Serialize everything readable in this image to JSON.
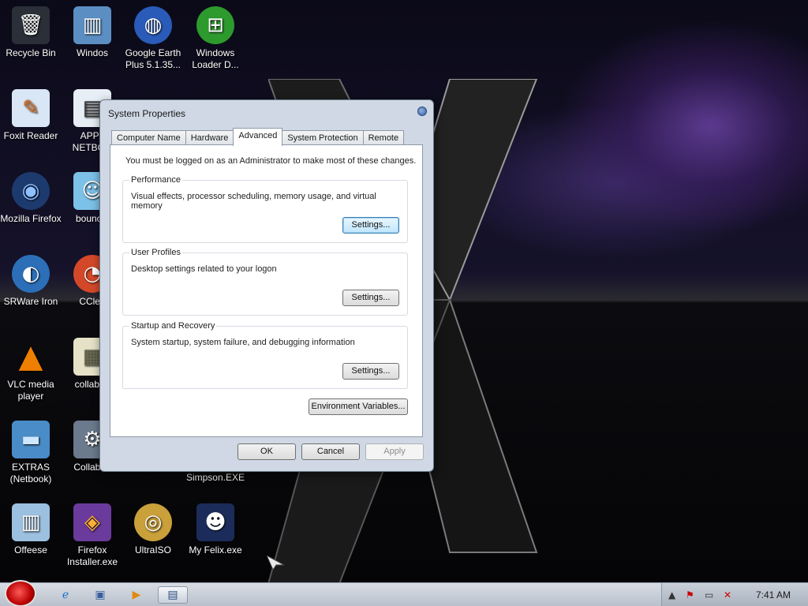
{
  "desktop": {
    "icons": [
      {
        "name": "recycle-bin-icon",
        "label": "Recycle Bin",
        "glyph": "🗑",
        "bg": "#2a2f38"
      },
      {
        "name": "windos-icon",
        "label": "Windos",
        "glyph": "▥",
        "bg": "#5b8fc4"
      },
      {
        "name": "google-earth-icon",
        "label": "Google Earth Plus 5.1.35...",
        "glyph": "◍",
        "bg": "#2a5bb8"
      },
      {
        "name": "windows-loader-icon",
        "label": "Windows Loader D...",
        "glyph": "⊞",
        "bg": "#2d9a2d"
      },
      {
        "name": "foxit-reader-icon",
        "label": "Foxit Reader",
        "glyph": "✎",
        "bg": "#d9e6f5"
      },
      {
        "name": "app-netbook-icon",
        "label": "APPL NETBOO",
        "glyph": "▤",
        "bg": "#e8eef5"
      },
      {
        "name": "firefox-icon",
        "label": "Mozilla Firefox",
        "glyph": "◉",
        "bg": "#1d3a6e"
      },
      {
        "name": "bouncing-icon",
        "label": "bouncin",
        "glyph": "☺",
        "bg": "#7cc1e8"
      },
      {
        "name": "srware-iron-icon",
        "label": "SRWare Iron",
        "glyph": "◐",
        "bg": "#2c6fb8"
      },
      {
        "name": "ccleaner-icon",
        "label": "CClea",
        "glyph": "◔",
        "bg": "#d4482a"
      },
      {
        "name": "vlc-icon",
        "label": "VLC media player",
        "glyph": "▲",
        "bg": "#ee7f00"
      },
      {
        "name": "collabnet-doc-icon",
        "label": "collabne",
        "glyph": "▦",
        "bg": "#e6e2c8"
      },
      {
        "name": "extras-folder-icon",
        "label": "EXTRAS (Netbook)",
        "glyph": "▬",
        "bg": "#4a8cc8"
      },
      {
        "name": "collabnet-icon",
        "label": "Collabne",
        "glyph": "⚙",
        "bg": "#6b7a8c"
      },
      {
        "name": "offeese-icon",
        "label": "Offeese",
        "glyph": "▥",
        "bg": "#9cc0e0"
      },
      {
        "name": "firefox-installer-icon",
        "label": "Firefox Installer.exe",
        "glyph": "◈",
        "bg": "#6a3b9c"
      },
      {
        "name": "ultraiso-icon",
        "label": "UltraISO",
        "glyph": "◎",
        "bg": "#c9a03a"
      },
      {
        "name": "my-felix-icon",
        "label": "My Felix.exe",
        "glyph": "☻",
        "bg": "#1c2c5a"
      }
    ],
    "extra_label": "Simpson.EXE"
  },
  "dialog": {
    "title": "System Properties",
    "tabs": [
      "Computer Name",
      "Hardware",
      "Advanced",
      "System Protection",
      "Remote"
    ],
    "active_tab": "Advanced",
    "note": "You must be logged on as an Administrator to make most of these changes.",
    "groups": [
      {
        "title": "Performance",
        "desc": "Visual effects, processor scheduling, memory usage, and virtual memory",
        "button": "Settings..."
      },
      {
        "title": "User Profiles",
        "desc": "Desktop settings related to your logon",
        "button": "Settings..."
      },
      {
        "title": "Startup and Recovery",
        "desc": "System startup, system failure, and debugging information",
        "button": "Settings..."
      }
    ],
    "env_button": "Environment Variables...",
    "ok": "OK",
    "cancel": "Cancel",
    "apply": "Apply"
  },
  "taskbar": {
    "clock": "7:41 AM"
  }
}
